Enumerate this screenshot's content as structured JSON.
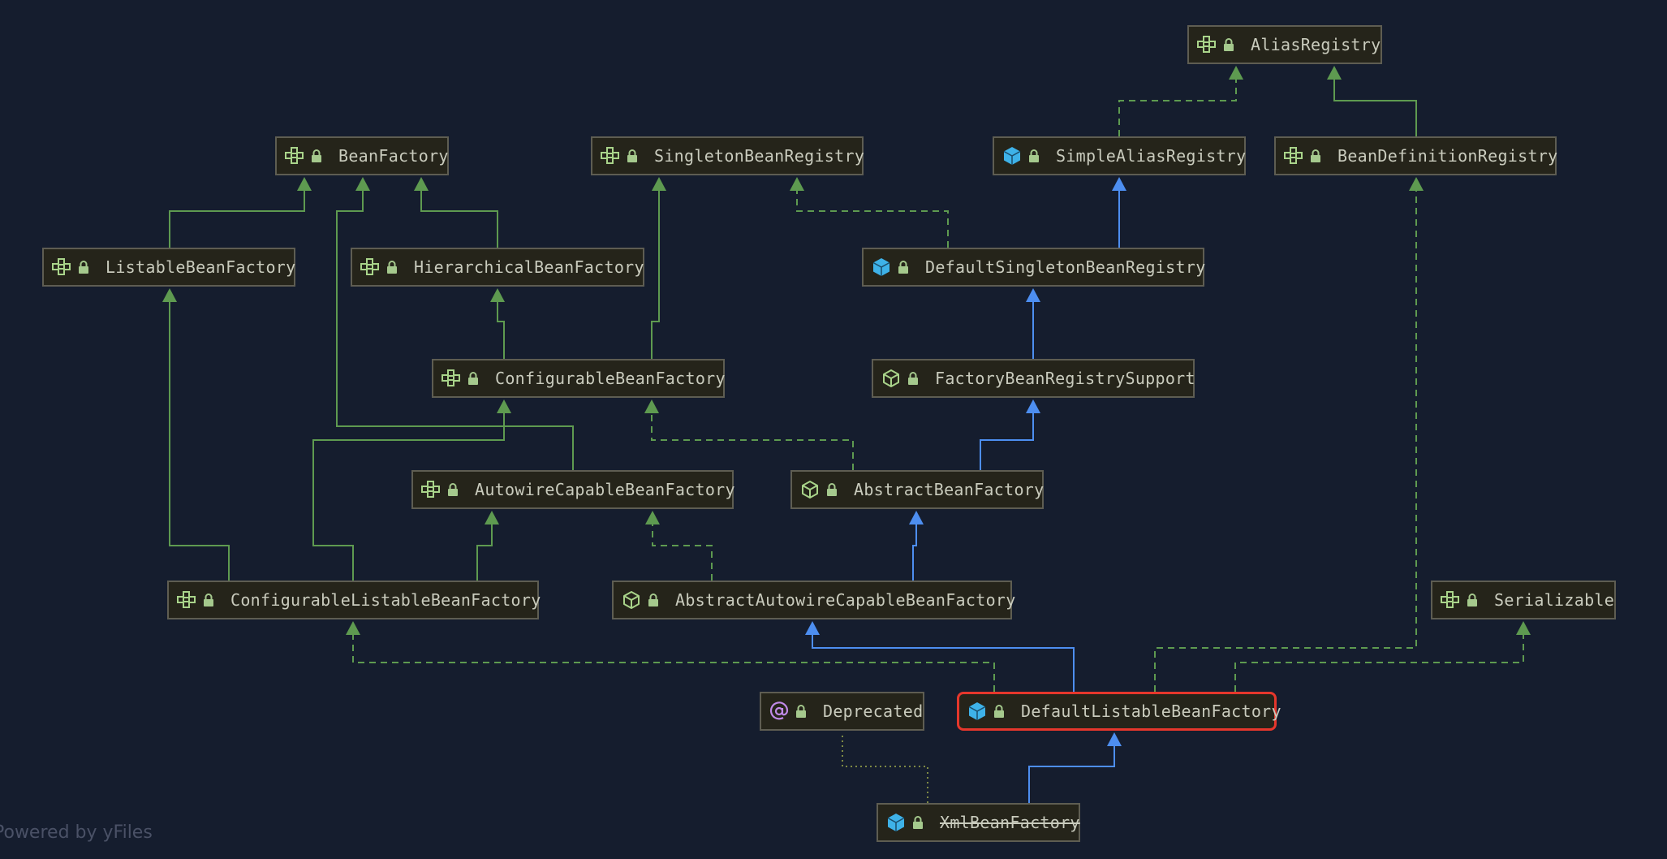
{
  "diagram": {
    "nodes": [
      {
        "id": "AliasRegistry",
        "label": "AliasRegistry",
        "icon": "interface-icon"
      },
      {
        "id": "BeanFactory",
        "label": "BeanFactory",
        "icon": "interface-icon"
      },
      {
        "id": "SingletonBeanRegistry",
        "label": "SingletonBeanRegistry",
        "icon": "interface-icon"
      },
      {
        "id": "SimpleAliasRegistry",
        "label": "SimpleAliasRegistry",
        "icon": "class-icon"
      },
      {
        "id": "BeanDefinitionRegistry",
        "label": "BeanDefinitionRegistry",
        "icon": "interface-icon"
      },
      {
        "id": "ListableBeanFactory",
        "label": "ListableBeanFactory",
        "icon": "interface-icon"
      },
      {
        "id": "HierarchicalBeanFactory",
        "label": "HierarchicalBeanFactory",
        "icon": "interface-icon"
      },
      {
        "id": "DefaultSingletonBeanRegistry",
        "label": "DefaultSingletonBeanRegistry",
        "icon": "class-icon"
      },
      {
        "id": "ConfigurableBeanFactory",
        "label": "ConfigurableBeanFactory",
        "icon": "interface-icon"
      },
      {
        "id": "FactoryBeanRegistrySupport",
        "label": "FactoryBeanRegistrySupport",
        "icon": "abstract-class-icon"
      },
      {
        "id": "AutowireCapableBeanFactory",
        "label": "AutowireCapableBeanFactory",
        "icon": "interface-icon"
      },
      {
        "id": "AbstractBeanFactory",
        "label": "AbstractBeanFactory",
        "icon": "abstract-class-icon"
      },
      {
        "id": "ConfigurableListableBeanFactory",
        "label": "ConfigurableListableBeanFactory",
        "icon": "interface-icon"
      },
      {
        "id": "AbstractAutowireCapableBeanFactory",
        "label": "AbstractAutowireCapableBeanFactory",
        "icon": "abstract-class-icon"
      },
      {
        "id": "Serializable",
        "label": "Serializable",
        "icon": "interface-icon"
      },
      {
        "id": "Deprecated",
        "label": "Deprecated",
        "icon": "annotation-icon"
      },
      {
        "id": "DefaultListableBeanFactory",
        "label": "DefaultListableBeanFactory",
        "icon": "class-icon",
        "selected": true
      },
      {
        "id": "XmlBeanFactory",
        "label": "XmlBeanFactory",
        "icon": "class-icon",
        "deprecated": true
      }
    ],
    "edges": [
      {
        "from": "BeanDefinitionRegistry",
        "to": "AliasRegistry",
        "relation": "extends"
      },
      {
        "from": "SimpleAliasRegistry",
        "to": "AliasRegistry",
        "relation": "implements"
      },
      {
        "from": "ListableBeanFactory",
        "to": "BeanFactory",
        "relation": "extends"
      },
      {
        "from": "HierarchicalBeanFactory",
        "to": "BeanFactory",
        "relation": "extends"
      },
      {
        "from": "AutowireCapableBeanFactory",
        "to": "BeanFactory",
        "relation": "extends"
      },
      {
        "from": "ConfigurableBeanFactory",
        "to": "SingletonBeanRegistry",
        "relation": "extends"
      },
      {
        "from": "DefaultSingletonBeanRegistry",
        "to": "SingletonBeanRegistry",
        "relation": "implements"
      },
      {
        "from": "DefaultSingletonBeanRegistry",
        "to": "SimpleAliasRegistry",
        "relation": "extends-class"
      },
      {
        "from": "ConfigurableBeanFactory",
        "to": "HierarchicalBeanFactory",
        "relation": "extends"
      },
      {
        "from": "FactoryBeanRegistrySupport",
        "to": "DefaultSingletonBeanRegistry",
        "relation": "extends-class"
      },
      {
        "from": "AbstractBeanFactory",
        "to": "FactoryBeanRegistrySupport",
        "relation": "extends-class"
      },
      {
        "from": "AbstractBeanFactory",
        "to": "ConfigurableBeanFactory",
        "relation": "implements"
      },
      {
        "from": "ConfigurableListableBeanFactory",
        "to": "ListableBeanFactory",
        "relation": "extends"
      },
      {
        "from": "ConfigurableListableBeanFactory",
        "to": "ConfigurableBeanFactory",
        "relation": "extends"
      },
      {
        "from": "ConfigurableListableBeanFactory",
        "to": "AutowireCapableBeanFactory",
        "relation": "extends"
      },
      {
        "from": "AbstractAutowireCapableBeanFactory",
        "to": "AbstractBeanFactory",
        "relation": "extends-class"
      },
      {
        "from": "AbstractAutowireCapableBeanFactory",
        "to": "AutowireCapableBeanFactory",
        "relation": "implements"
      },
      {
        "from": "DefaultListableBeanFactory",
        "to": "AbstractAutowireCapableBeanFactory",
        "relation": "extends-class"
      },
      {
        "from": "DefaultListableBeanFactory",
        "to": "ConfigurableListableBeanFactory",
        "relation": "implements"
      },
      {
        "from": "DefaultListableBeanFactory",
        "to": "BeanDefinitionRegistry",
        "relation": "implements"
      },
      {
        "from": "DefaultListableBeanFactory",
        "to": "Serializable",
        "relation": "implements"
      },
      {
        "from": "XmlBeanFactory",
        "to": "DefaultListableBeanFactory",
        "relation": "extends-class"
      },
      {
        "from": "XmlBeanFactory",
        "to": "Deprecated",
        "relation": "annotated"
      }
    ],
    "colors": {
      "background": "#151d2e",
      "interface_edge": "#5e9a50",
      "class_edge": "#4d8ef0",
      "annotation_edge": "#7e8a44",
      "interface_icon": "#a9d48a",
      "class_icon": "#3eb2e8",
      "annotation_icon": "#c08ae8",
      "lock": "#a5c98d",
      "selected_border": "#e5372c"
    }
  },
  "footer": {
    "text": "Powered by yFiles"
  }
}
